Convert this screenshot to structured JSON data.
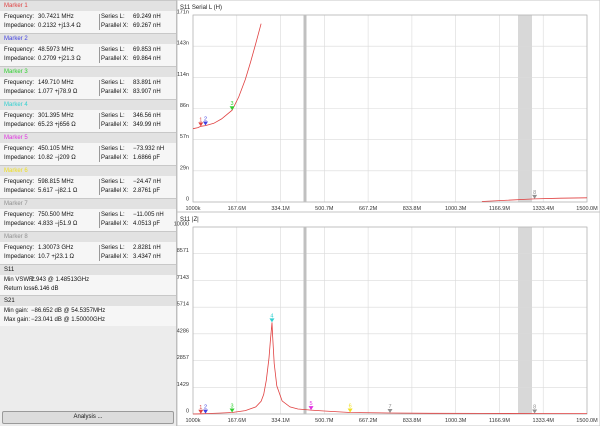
{
  "markers": [
    {
      "label": "Marker 1",
      "color": "#e04040",
      "freq": "30.7421",
      "freq_unit": "MHz",
      "imp": "0.2132 +j13.4 Ω",
      "sl_label": "Series L:",
      "sl": "69.249 nH",
      "px_label": "Parallel X:",
      "px": "69.267 nH"
    },
    {
      "label": "Marker 2",
      "color": "#4040e0",
      "freq": "48.5973",
      "freq_unit": "MHz",
      "imp": "0.2709 +j21.3 Ω",
      "sl_label": "Series L:",
      "sl": "69.853 nH",
      "px_label": "Parallel X:",
      "px": "69.864 nH"
    },
    {
      "label": "Marker 3",
      "color": "#30d030",
      "freq": "149.710",
      "freq_unit": "MHz",
      "imp": "1.077 +j78.9 Ω",
      "sl_label": "Series L:",
      "sl": "83.891 nH",
      "px_label": "Parallel X:",
      "px": "83.907 nH"
    },
    {
      "label": "Marker 4",
      "color": "#30d0d0",
      "freq": "301.395",
      "freq_unit": "MHz",
      "imp": "65.23 +j656 Ω",
      "sl_label": "Series L:",
      "sl": "346.56 nH",
      "px_label": "Parallel X:",
      "px": "349.99 nH"
    },
    {
      "label": "Marker 5",
      "color": "#e030e0",
      "freq": "450.105",
      "freq_unit": "MHz",
      "imp": "10.82 −j209 Ω",
      "sl_label": "Series L:",
      "sl": "−73.932 nH",
      "px_label": "Parallel X:",
      "px": "1.6866 pF"
    },
    {
      "label": "Marker 6",
      "color": "#f0e020",
      "freq": "598.815",
      "freq_unit": "MHz",
      "imp": "5.617 −j82.1 Ω",
      "sl_label": "Series L:",
      "sl": "−24.47 nH",
      "px_label": "Parallel X:",
      "px": "2.8761 pF"
    },
    {
      "label": "Marker 7",
      "color": "#909090",
      "freq": "750.500",
      "freq_unit": "MHz",
      "imp": "4.833 −j51.9 Ω",
      "sl_label": "Series L:",
      "sl": "−11.005 nH",
      "px_label": "Parallel X:",
      "px": "4.0513 pF"
    },
    {
      "label": "Marker 8",
      "color": "#909090",
      "freq": "1.30073",
      "freq_unit": "GHz",
      "imp": "10.7 +j23.1 Ω",
      "sl_label": "Series L:",
      "sl": "2.8281 nH",
      "px_label": "Parallel X:",
      "px": "3.4347 nH"
    }
  ],
  "labels": {
    "frequency": "Frequency:",
    "impedance": "Impedance:"
  },
  "s11": {
    "title": "S11",
    "r1_label": "Min VSWR:",
    "r1": "2.943 @ 1.48513GHz",
    "r2_label": "Return loss:",
    "r2": "−6.146 dB"
  },
  "s21": {
    "title": "S21",
    "r1_label": "Min gain:",
    "r1": "−86.652 dB @ 54.5357MHz",
    "r2_label": "Max gain:",
    "r2": "−23.041 dB @ 1.50000GHz"
  },
  "analysis_button": "Analysis ...",
  "chart_data": [
    {
      "type": "line",
      "title": "S11 Serial L (H)",
      "x_ticks": [
        "1000k",
        "167.6M",
        "334.1M",
        "500.7M",
        "667.2M",
        "833.8M",
        "1000.3M",
        "1166.9M",
        "1333.4M",
        "1500.0M"
      ],
      "y_ticks": [
        "0",
        "29n",
        "57n",
        "86n",
        "114n",
        "143n",
        "171n"
      ],
      "xlim_mhz": [
        1,
        1500
      ],
      "ylim": [
        0,
        171
      ],
      "grid": true,
      "markers": [
        {
          "label": "1",
          "x": 30.7
        },
        {
          "label": "2",
          "x": 48.6
        },
        {
          "label": "3",
          "x": 149.7
        },
        {
          "label": "8",
          "x": 1300.7
        }
      ],
      "series": [
        {
          "color": "#e04040",
          "x": [
            1,
            20,
            30.7,
            48.6,
            80,
            110,
            149.7,
            175,
            200,
            220,
            240,
            260,
            275,
            290,
            301,
            320,
            350,
            500,
            700,
            900,
            1100,
            1300,
            1400,
            1500
          ],
          "values": [
            67,
            68,
            69.2,
            69.9,
            72,
            76,
            83.9,
            96,
            112,
            128,
            145,
            163,
            178,
            195,
            210,
            -20,
            -5,
            -3,
            -2,
            -1,
            0.5,
            2.8,
            3.5,
            3.8
          ]
        }
      ]
    },
    {
      "type": "line",
      "title": "S11 |Z|",
      "x_ticks": [
        "1000k",
        "167.6M",
        "334.1M",
        "500.7M",
        "667.2M",
        "833.8M",
        "1000.3M",
        "1166.9M",
        "1333.4M",
        "1500.0M"
      ],
      "y_ticks": [
        "0",
        "1429",
        "2857",
        "4286",
        "5714",
        "7143",
        "8571",
        "10000"
      ],
      "xlim_mhz": [
        1,
        1500
      ],
      "ylim": [
        0,
        10000
      ],
      "grid": true,
      "markers": [
        {
          "label": "1",
          "x": 30.7
        },
        {
          "label": "2",
          "x": 48.6
        },
        {
          "label": "3",
          "x": 149.7
        },
        {
          "label": "4",
          "x": 301.4
        },
        {
          "label": "5",
          "x": 450.1
        },
        {
          "label": "6",
          "x": 598.8
        },
        {
          "label": "7",
          "x": 750.5
        },
        {
          "label": "8",
          "x": 1300.7
        }
      ],
      "series": [
        {
          "color": "#e04040",
          "x": [
            1,
            30.7,
            48.6,
            100,
            149.7,
            200,
            240,
            260,
            270,
            280,
            290,
            296,
            300,
            301.4,
            304,
            310,
            320,
            340,
            370,
            400,
            450,
            500,
            598.8,
            750.5,
            900,
            1100,
            1300.7,
            1500
          ],
          "values": [
            2,
            13,
            21,
            50,
            79,
            180,
            380,
            680,
            1050,
            1800,
            3000,
            4000,
            4650,
            4900,
            4200,
            2700,
            1500,
            700,
            380,
            270,
            209,
            160,
            82,
            52,
            40,
            30,
            25,
            20
          ]
        }
      ]
    }
  ]
}
